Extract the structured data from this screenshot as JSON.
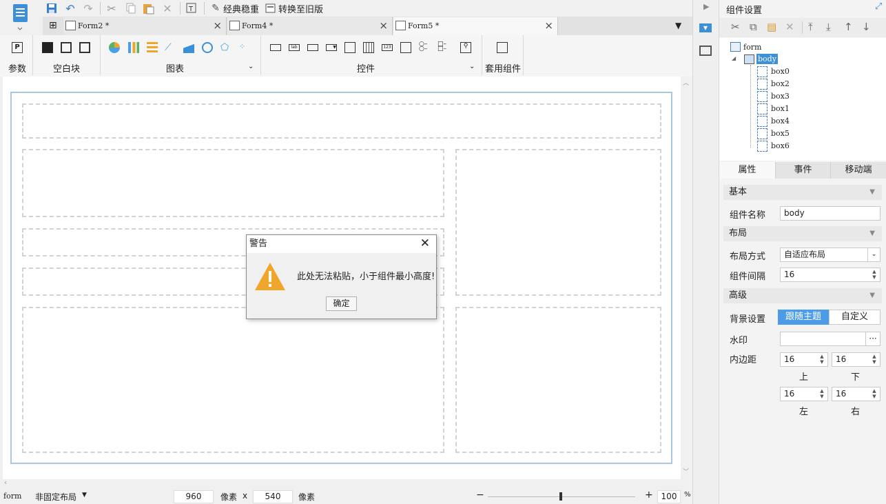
{
  "toolbar": {
    "classic_label": "经典稳重",
    "convert_label": "转换至旧版"
  },
  "tabs": [
    {
      "label": "Form2 *"
    },
    {
      "label": "Form4 *"
    },
    {
      "label": "Form5 *"
    }
  ],
  "ribbon": {
    "params": "参数",
    "blank": "空白块",
    "chart": "图表",
    "controls": "控件",
    "template": "套用组件"
  },
  "status": {
    "form": "form",
    "layout": "非固定布局",
    "width": "960",
    "unit1": "像素",
    "x": "x",
    "height": "540",
    "unit2": "像素",
    "zoom": "100",
    "pct": "%"
  },
  "panel": {
    "title": "组件设置",
    "tree": {
      "root": "form",
      "body": "body",
      "children": [
        "box0",
        "box2",
        "box3",
        "box1",
        "box4",
        "box5",
        "box6"
      ]
    },
    "tabs": [
      "属性",
      "事件",
      "移动端"
    ],
    "sections": {
      "basic": "基本",
      "layout": "布局",
      "advanced": "高级"
    },
    "name_label": "组件名称",
    "name_value": "body",
    "layout_mode_label": "布局方式",
    "layout_mode_value": "自适应布局",
    "gap_label": "组件间隔",
    "gap_value": "16",
    "bg_label": "背景设置",
    "bg_follow": "跟随主题",
    "bg_custom": "自定义",
    "watermark_label": "水印",
    "watermark_btn": "···",
    "padding_label": "内边距",
    "padding": {
      "top": "16",
      "bottom": "16",
      "left": "16",
      "right": "16",
      "top_l": "上",
      "bottom_l": "下",
      "left_l": "左",
      "right_l": "右"
    }
  },
  "dialog": {
    "title": "警告",
    "message": "此处无法粘贴，小于组件最小高度!",
    "ok": "确定"
  },
  "colors": {
    "accent": "#4a9be8",
    "frame": "#a9c7e3",
    "warning": "#f0a52b"
  }
}
